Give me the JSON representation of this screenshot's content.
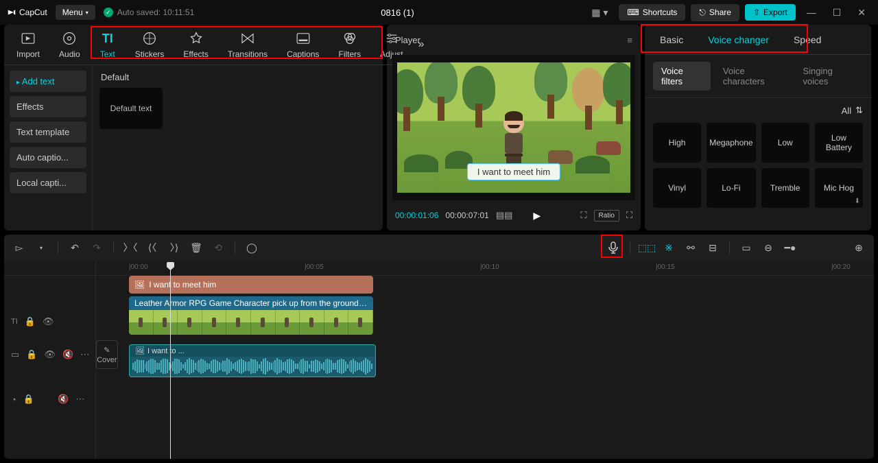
{
  "titlebar": {
    "app_name": "CapCut",
    "menu_label": "Menu",
    "autosave_label": "Auto saved: 10:11:51",
    "project_name": "0816 (1)",
    "shortcuts_label": "Shortcuts",
    "share_label": "Share",
    "export_label": "Export"
  },
  "left_panel": {
    "tabs": [
      {
        "label": "Import"
      },
      {
        "label": "Audio"
      },
      {
        "label": "Text",
        "active": true
      },
      {
        "label": "Stickers"
      },
      {
        "label": "Effects"
      },
      {
        "label": "Transitions"
      },
      {
        "label": "Captions"
      },
      {
        "label": "Filters"
      },
      {
        "label": "Adjust"
      }
    ],
    "sidebar": [
      {
        "label": "Add text",
        "active": true
      },
      {
        "label": "Effects"
      },
      {
        "label": "Text template"
      },
      {
        "label": "Auto captio..."
      },
      {
        "label": "Local capti..."
      }
    ],
    "content_label": "Default",
    "preset_label": "Default text"
  },
  "player": {
    "header": "Player",
    "subtitle_text": "I want to meet him",
    "time_current": "00:00:01:06",
    "time_total": "00:00:07:01",
    "ratio_label": "Ratio"
  },
  "right_panel": {
    "tabs": [
      {
        "label": "Basic"
      },
      {
        "label": "Voice changer",
        "active": true
      },
      {
        "label": "Speed"
      }
    ],
    "sub_tabs": [
      {
        "label": "Voice filters",
        "active": true
      },
      {
        "label": "Voice characters"
      },
      {
        "label": "Singing voices"
      }
    ],
    "filter_all": "All",
    "voices": [
      {
        "label": "High"
      },
      {
        "label": "Megaphone"
      },
      {
        "label": "Low"
      },
      {
        "label": "Low Battery"
      },
      {
        "label": "Vinyl"
      },
      {
        "label": "Lo-Fi"
      },
      {
        "label": "Tremble"
      },
      {
        "label": "Mic Hog",
        "dl": true
      }
    ]
  },
  "timeline": {
    "cover_label": "Cover",
    "ticks": [
      "00:00",
      "00:05",
      "00:10",
      "00:15",
      "00:20"
    ],
    "text_clip_label": "I want to meet him",
    "video_clip_label": "Leather Armor RPG Game Character pick up from the ground in the",
    "audio_clip_label": "I want to ..."
  }
}
